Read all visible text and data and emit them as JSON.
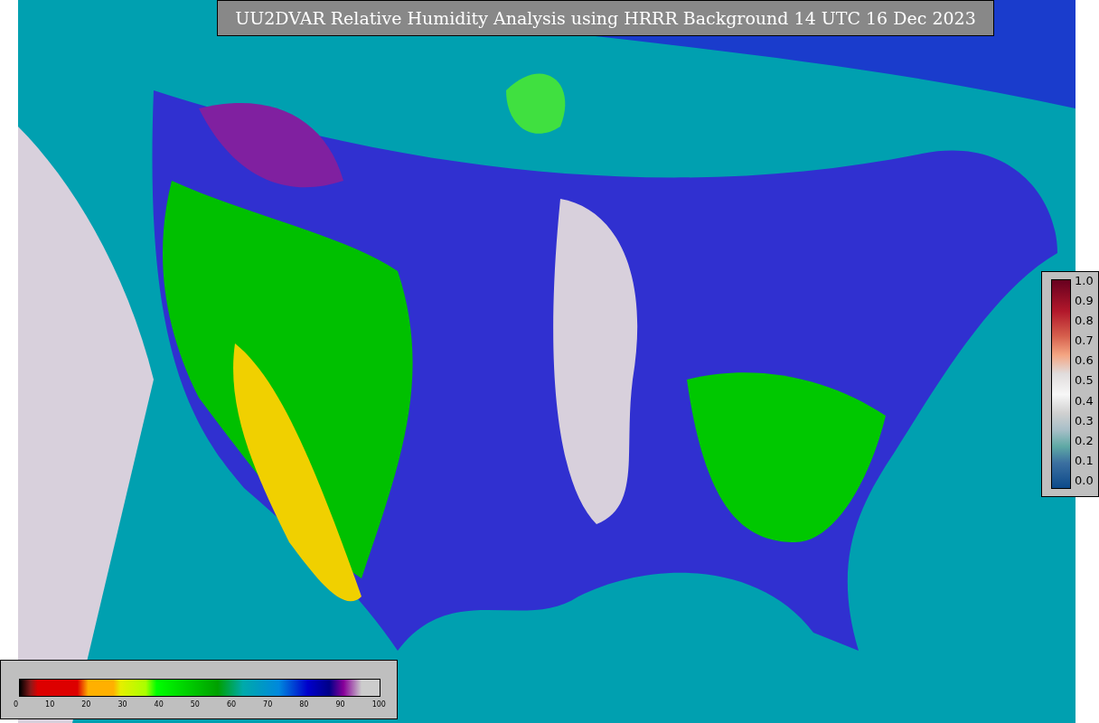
{
  "title": "UU2DVAR Relative Humidity Analysis using HRRR Background 14 UTC 16 Dec 2023",
  "station_colorbar": {
    "ticks": [
      "1.0",
      "0.9",
      "0.8",
      "0.7",
      "0.6",
      "0.5",
      "0.4",
      "0.3",
      "0.2",
      "0.1",
      "0.0"
    ]
  },
  "humidity_colorbar": {
    "ticks": [
      "0",
      "10",
      "20",
      "30",
      "40",
      "50",
      "60",
      "70",
      "80",
      "90",
      "100"
    ]
  }
}
